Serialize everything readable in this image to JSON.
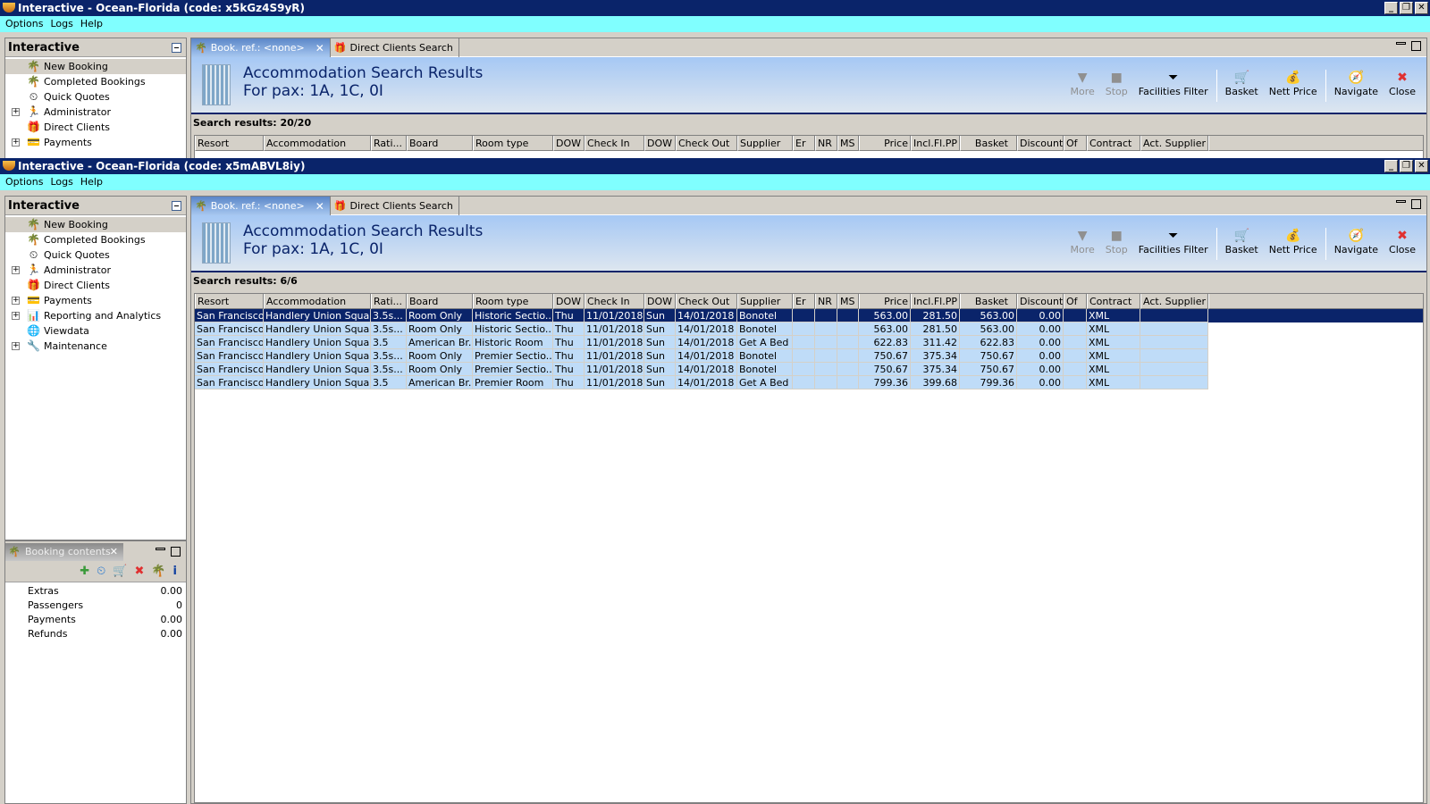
{
  "windows": [
    {
      "title": "Interactive - Ocean-Florida (code: x5kGz4S9yR)",
      "menu": [
        "Options",
        "Logs",
        "Help"
      ],
      "panel_title": "Interactive",
      "tree": [
        {
          "label": "New Booking",
          "icon": "palm-tree-icon",
          "glyph": "🌴",
          "expand": false,
          "selected": true
        },
        {
          "label": "Completed Bookings",
          "icon": "palm-money-icon",
          "glyph": "🌴",
          "expand": false
        },
        {
          "label": "Quick Quotes",
          "icon": "clock-icon",
          "glyph": "⏲",
          "expand": false
        },
        {
          "label": "Administrator",
          "icon": "runner-icon",
          "glyph": "🏃",
          "expand": true
        },
        {
          "label": "Direct Clients",
          "icon": "client-icon",
          "glyph": "🎁",
          "expand": false
        },
        {
          "label": "Payments",
          "icon": "payment-card-icon",
          "glyph": "💳",
          "expand": true
        }
      ],
      "tabs": [
        {
          "label": "Book. ref.: <none>",
          "active": true,
          "closable": true
        },
        {
          "label": "Direct Clients Search",
          "active": false
        }
      ],
      "header_title": "Accommodation Search Results",
      "header_subtitle": "For pax: 1A, 1C, 0I",
      "results_label": "Search results: 20/20",
      "rows": []
    },
    {
      "title": "Interactive - Ocean-Florida (code: x5mABVL8iy)",
      "menu": [
        "Options",
        "Logs",
        "Help"
      ],
      "panel_title": "Interactive",
      "tree": [
        {
          "label": "New Booking",
          "icon": "palm-tree-icon",
          "glyph": "🌴",
          "expand": false,
          "selected": true
        },
        {
          "label": "Completed Bookings",
          "icon": "palm-money-icon",
          "glyph": "🌴",
          "expand": false
        },
        {
          "label": "Quick Quotes",
          "icon": "clock-icon",
          "glyph": "⏲",
          "expand": false
        },
        {
          "label": "Administrator",
          "icon": "runner-icon",
          "glyph": "🏃",
          "expand": true
        },
        {
          "label": "Direct Clients",
          "icon": "client-icon",
          "glyph": "🎁",
          "expand": false
        },
        {
          "label": "Payments",
          "icon": "payment-card-icon",
          "glyph": "💳",
          "expand": true
        },
        {
          "label": "Reporting and Analytics",
          "icon": "report-icon",
          "glyph": "📊",
          "expand": true
        },
        {
          "label": "Viewdata",
          "icon": "globe-icon",
          "glyph": "🌐",
          "expand": false
        },
        {
          "label": "Maintenance",
          "icon": "maintenance-icon",
          "glyph": "🔧",
          "expand": true
        }
      ],
      "tabs": [
        {
          "label": "Book. ref.: <none>",
          "active": true,
          "closable": true
        },
        {
          "label": "Direct Clients Search",
          "active": false
        }
      ],
      "header_title": "Accommodation Search Results",
      "header_subtitle": "For pax: 1A, 1C, 0I",
      "results_label": "Search results: 6/6",
      "rows": [
        [
          "San Francisco",
          "Handlery Union Squa...",
          "3.5s...",
          "Room Only",
          "Historic Sectio...",
          "Thu",
          "11/01/2018",
          "Sun",
          "14/01/2018",
          "Bonotel",
          "",
          "",
          "",
          "563.00",
          "281.50",
          "563.00",
          "0.00",
          "",
          "XML",
          ""
        ],
        [
          "San Francisco",
          "Handlery Union Squa...",
          "3.5s...",
          "Room Only",
          "Historic Sectio...",
          "Thu",
          "11/01/2018",
          "Sun",
          "14/01/2018",
          "Bonotel",
          "",
          "",
          "",
          "563.00",
          "281.50",
          "563.00",
          "0.00",
          "",
          "XML",
          ""
        ],
        [
          "San Francisco",
          "Handlery Union Squa...",
          "3.5",
          "American Br...",
          "Historic Room",
          "Thu",
          "11/01/2018",
          "Sun",
          "14/01/2018",
          "Get A Bed",
          "",
          "",
          "",
          "622.83",
          "311.42",
          "622.83",
          "0.00",
          "",
          "XML",
          ""
        ],
        [
          "San Francisco",
          "Handlery Union Squa...",
          "3.5s...",
          "Room Only",
          "Premier Sectio...",
          "Thu",
          "11/01/2018",
          "Sun",
          "14/01/2018",
          "Bonotel",
          "",
          "",
          "",
          "750.67",
          "375.34",
          "750.67",
          "0.00",
          "",
          "XML",
          ""
        ],
        [
          "San Francisco",
          "Handlery Union Squa...",
          "3.5s...",
          "Room Only",
          "Premier Sectio...",
          "Thu",
          "11/01/2018",
          "Sun",
          "14/01/2018",
          "Bonotel",
          "",
          "",
          "",
          "750.67",
          "375.34",
          "750.67",
          "0.00",
          "",
          "XML",
          ""
        ],
        [
          "San Francisco",
          "Handlery Union Squa...",
          "3.5",
          "American Br...",
          "Premier Room",
          "Thu",
          "11/01/2018",
          "Sun",
          "14/01/2018",
          "Get A Bed",
          "",
          "",
          "",
          "799.36",
          "399.68",
          "799.36",
          "0.00",
          "",
          "XML",
          ""
        ]
      ],
      "selected_row": 0
    }
  ],
  "columns": [
    "Resort",
    "Accommodation",
    "Rati...",
    "Board",
    "Room type",
    "DOW",
    "Check In",
    "DOW",
    "Check Out",
    "Supplier",
    "Er",
    "NR",
    "MS",
    "Price",
    "Incl.Fl.PP",
    "Basket",
    "Discount",
    "Of",
    "Contract",
    "Act. Supplier"
  ],
  "toolbar": [
    {
      "label": "More",
      "icon": "more-arrow-icon",
      "glyph": "▼",
      "disabled": true
    },
    {
      "label": "Stop",
      "icon": "stop-icon",
      "glyph": "■",
      "disabled": true
    },
    {
      "label": "Facilities Filter",
      "icon": "funnel-icon",
      "glyph": "⏷",
      "disabled": false
    },
    {
      "sep": true
    },
    {
      "label": "Basket",
      "icon": "cart-icon",
      "glyph": "🛒",
      "disabled": false
    },
    {
      "label": "Nett Price",
      "icon": "nett-price-icon",
      "glyph": "💰",
      "disabled": false
    },
    {
      "sep": true
    },
    {
      "label": "Navigate",
      "icon": "compass-icon",
      "glyph": "🧭",
      "disabled": false
    },
    {
      "label": "Close",
      "icon": "close-icon",
      "glyph": "✖",
      "disabled": false
    }
  ],
  "booking_contents": {
    "tab_label": "Booking contents",
    "tools": [
      {
        "icon": "add-icon",
        "glyph": "✚",
        "color": "#3a9a3a"
      },
      {
        "icon": "clock-refresh-icon",
        "glyph": "⏲",
        "color": "#2a7ad0"
      },
      {
        "icon": "cart-transfer-icon",
        "glyph": "🛒",
        "color": "#808080"
      },
      {
        "icon": "delete-icon",
        "glyph": "✖",
        "color": "#e03030"
      },
      {
        "icon": "palm-tree-icon",
        "glyph": "🌴",
        "color": "#3a9a3a"
      },
      {
        "icon": "info-icon",
        "glyph": "i",
        "color": "#1040a0"
      }
    ],
    "rows": [
      {
        "label": "Extras",
        "value": "0.00"
      },
      {
        "label": "Passengers",
        "value": "0"
      },
      {
        "label": "Payments",
        "value": "0.00"
      },
      {
        "label": "Refunds",
        "value": "0.00"
      }
    ]
  },
  "colors": {
    "title_bar": "#0a246a",
    "menu_bar": "#80ffff",
    "row_bg": "#bfdcf8",
    "selected_row": "#0a246a"
  }
}
